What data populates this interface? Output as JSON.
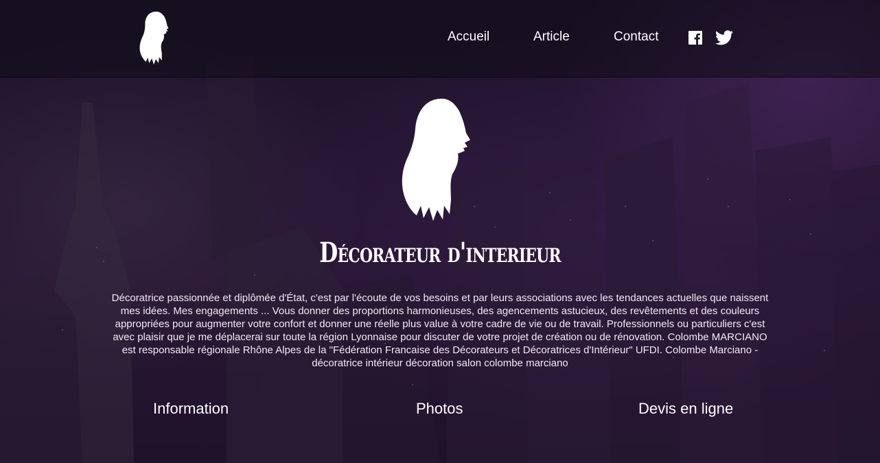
{
  "colors": {
    "background_dark": "#1c1224",
    "accent_purple": "#6e3c8c",
    "text": "#ffffff"
  },
  "header": {
    "logo_icon": "woman-silhouette-icon",
    "nav": [
      {
        "label": "Accueil"
      },
      {
        "label": "Article"
      },
      {
        "label": "Contact"
      }
    ],
    "social": [
      {
        "icon": "facebook-icon"
      },
      {
        "icon": "twitter-icon"
      }
    ]
  },
  "hero": {
    "icon": "woman-silhouette-icon",
    "title": "Décorateur d'interieur",
    "text": "Décoratrice passionnée et diplômée d'État, c'est par l'écoute de vos besoins et par leurs associations avec les tendances actuelles que naissent mes idées. Mes engagements ... Vous donner des proportions harmonieuses, des agencements astucieux, des revêtements et des couleurs appropriées pour augmenter votre confort et donner une réelle plus value à votre cadre de vie ou de travail. Professionnels ou particuliers c'est avec plaisir que je me déplacerai sur toute la région Lyonnaise pour discuter de votre projet de création ou de rénovation. Colombe MARCIANO est responsable régionale Rhône Alpes de la \"Fédération Francaise des Décorateurs et Décoratrices d'Intérieur\" UFDI. Colombe Marciano - décoratrice intérieur décoration salon colombe marciano"
  },
  "sections": [
    {
      "label": "Information"
    },
    {
      "label": "Photos"
    },
    {
      "label": "Devis en ligne"
    }
  ]
}
